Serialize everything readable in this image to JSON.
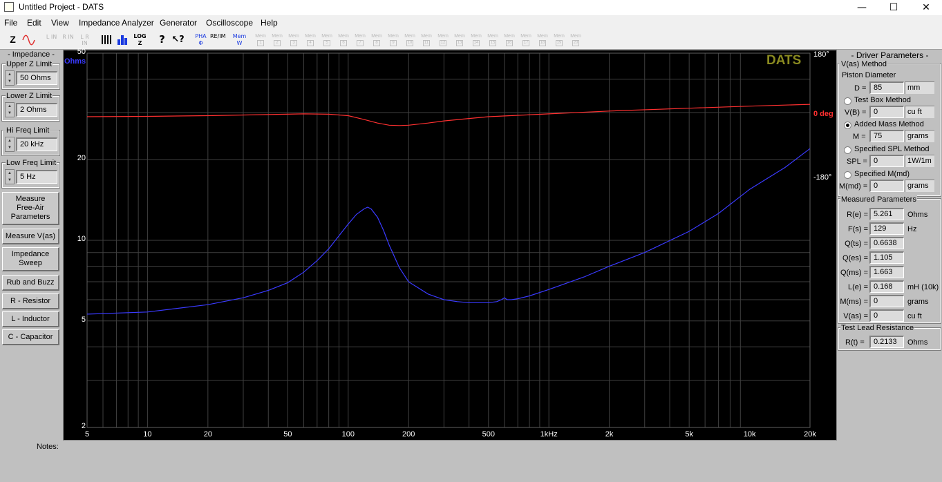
{
  "window": {
    "title": "Untitled Project - DATS",
    "minimize": "—",
    "maximize": "☐",
    "close": "✕"
  },
  "menu": [
    "File",
    "Edit",
    "View",
    "Impedance Analyzer",
    "Generator",
    "Oscilloscope",
    "Help"
  ],
  "toolbar": {
    "z_label": "Z",
    "log_label": "LOG",
    "pha_label": "PHA",
    "reim_label": "RE/IM",
    "mem_label": "Mem",
    "mem_slots": [
      "1",
      "2",
      "3",
      "4",
      "5",
      "6",
      "7",
      "8",
      "9",
      "10",
      "11",
      "12",
      "13",
      "14",
      "15",
      "16",
      "17",
      "18",
      "19",
      "20"
    ],
    "l_in": "L IN",
    "r_in": "R IN",
    "lr_in": "L R IN"
  },
  "left": {
    "impedance_title": "- Impedance -",
    "upper_label": "Upper Z Limit",
    "upper_value": "50 Ohms",
    "lower_label": "Lower Z Limit",
    "lower_value": "2 Ohms",
    "hifreq_label": "Hi Freq Limit",
    "hifreq_value": "20 kHz",
    "lowfreq_label": "Low Freq Limit",
    "lowfreq_value": "5 Hz",
    "buttons": [
      "Measure\nFree-Air\nParameters",
      "Measure V(as)",
      "Impedance\nSweep",
      "Rub and Buzz",
      "R - Resistor",
      "L - Inductor",
      "C - Capacitor"
    ]
  },
  "plot": {
    "brand": "DATS",
    "ohms_label": "Ohms",
    "phase_labels": [
      "180°",
      "0 deg",
      "-180°"
    ],
    "colors": {
      "impedance": "#3a3aff",
      "phase": "#ff3030",
      "brand": "#8a8a20",
      "grid": "#404040"
    }
  },
  "chart_data": {
    "type": "line",
    "x_scale": "log",
    "y_scale": "log",
    "xlim": [
      5,
      20000
    ],
    "ylim": [
      2,
      50
    ],
    "y2lim": [
      -180,
      180
    ],
    "x_ticks": [
      "5",
      "10",
      "20",
      "50",
      "100",
      "200",
      "500",
      "1kHz",
      "2k",
      "5k",
      "10k",
      "20k"
    ],
    "x_tick_values": [
      5,
      10,
      20,
      50,
      100,
      200,
      500,
      1000,
      2000,
      5000,
      10000,
      20000
    ],
    "y_ticks": [
      "2",
      "5",
      "10",
      "20",
      "50"
    ],
    "y_tick_values": [
      2,
      5,
      10,
      20,
      50
    ],
    "series": [
      {
        "axis": "left",
        "x": [
          5,
          10,
          20,
          30,
          40,
          50,
          60,
          70,
          80,
          90,
          100,
          110,
          120,
          125,
          130,
          140,
          150,
          160,
          180,
          200,
          250,
          300,
          350,
          400,
          450,
          500,
          550,
          580,
          600,
          620,
          650,
          700,
          800,
          1000,
          1500,
          2000,
          3000,
          5000,
          7000,
          10000,
          15000,
          20000
        ],
        "y": [
          5.3,
          5.4,
          5.75,
          6.1,
          6.5,
          6.95,
          7.6,
          8.4,
          9.3,
          10.4,
          11.5,
          12.5,
          13.1,
          13.3,
          13.1,
          12.2,
          10.9,
          9.6,
          7.9,
          7.0,
          6.3,
          6.0,
          5.9,
          5.85,
          5.85,
          5.85,
          5.9,
          6.0,
          6.1,
          6.0,
          6.0,
          6.05,
          6.2,
          6.55,
          7.3,
          8.0,
          9.0,
          10.8,
          12.6,
          15.5,
          18.7,
          22.0
        ]
      },
      {
        "axis": "right",
        "x": [
          5,
          10,
          20,
          40,
          60,
          80,
          100,
          120,
          140,
          160,
          180,
          200,
          250,
          300,
          400,
          500,
          700,
          1000,
          2000,
          5000,
          10000,
          20000
        ],
        "y": [
          0,
          1,
          3,
          6,
          8,
          7,
          3,
          -8,
          -18,
          -24,
          -25,
          -24,
          -18,
          -12,
          -5,
          0,
          4,
          8,
          16,
          24,
          30,
          35
        ]
      }
    ]
  },
  "right": {
    "title": "- Driver Parameters -",
    "vas_method": "V(as) Method",
    "piston_label": "Piston Diameter",
    "d_label": "D =",
    "d_value": "85",
    "d_unit": "mm",
    "testbox_label": "Test Box Method",
    "vb_label": "V(B) =",
    "vb_value": "0",
    "vb_unit": "cu ft",
    "addedmass_label": "Added Mass Method",
    "m_label": "M =",
    "m_value": "75",
    "m_unit": "grams",
    "spl_method_label": "Specified SPL Method",
    "spl_label": "SPL =",
    "spl_value": "0",
    "spl_unit": "1W/1m",
    "mmd_method_label": "Specified M(md)",
    "mmd_label": "M(md) =",
    "mmd_value": "0",
    "mmd_unit": "grams",
    "measured_title": "Measured Parameters",
    "measured": [
      {
        "label": "R(e) =",
        "value": "5.261",
        "unit": "Ohms"
      },
      {
        "label": "F(s) =",
        "value": "129",
        "unit": "Hz"
      },
      {
        "label": "Q(ts) =",
        "value": "0.6638",
        "unit": ""
      },
      {
        "label": "Q(es) =",
        "value": "1.105",
        "unit": ""
      },
      {
        "label": "Q(ms) =",
        "value": "1.663",
        "unit": ""
      },
      {
        "label": "L(e) =",
        "value": "0.168",
        "unit": "mH (10k)"
      },
      {
        "label": "M(ms) =",
        "value": "0",
        "unit": "grams"
      },
      {
        "label": "V(as) =",
        "value": "0",
        "unit": "cu ft"
      }
    ],
    "lead_title": "Test Lead Resistance",
    "rt_label": "R(t) =",
    "rt_value": "0.2133",
    "rt_unit": "Ohms"
  },
  "notes_label": "Notes:"
}
